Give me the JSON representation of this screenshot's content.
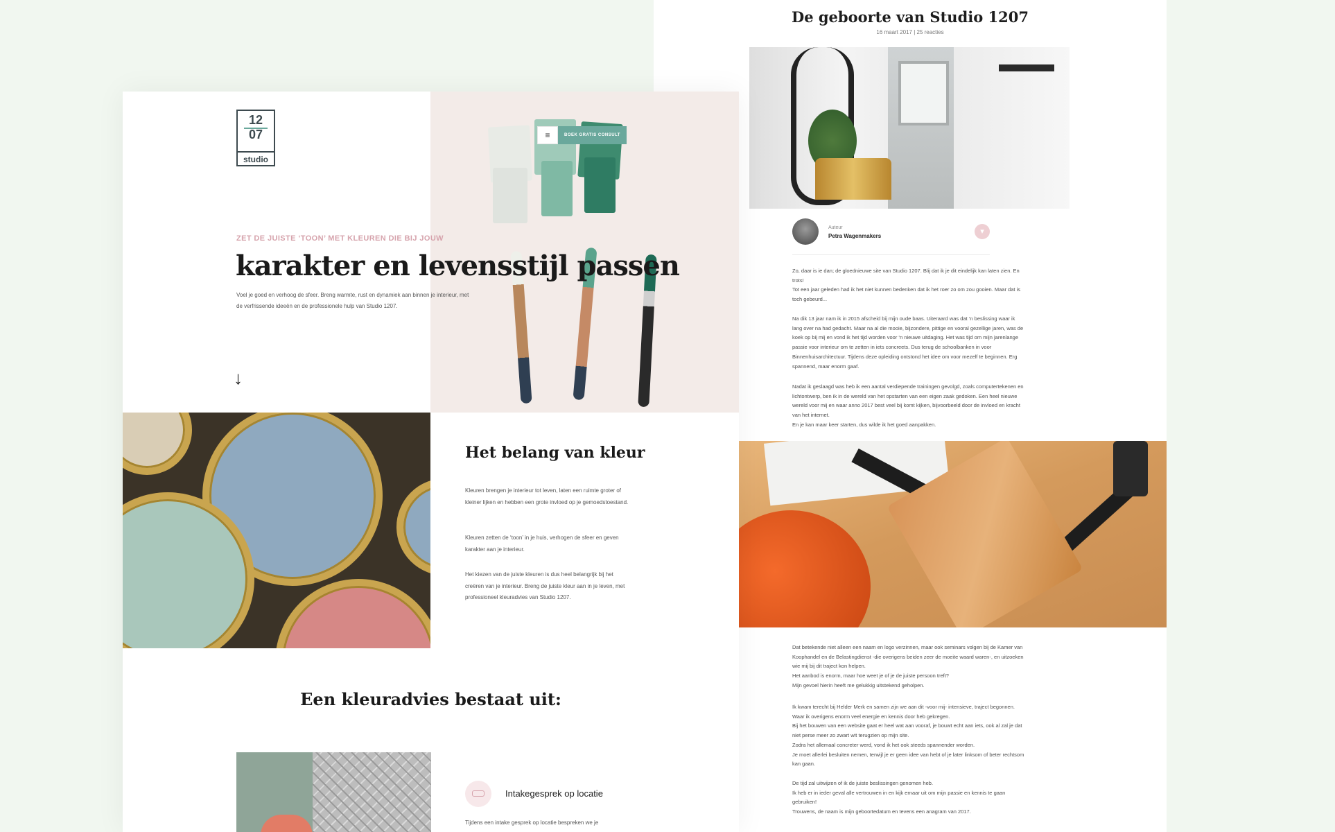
{
  "blog": {
    "title": "De geboorte van Studio 1207",
    "meta": "16 maart 2017 | 25 reacties",
    "author_label": "Auteur",
    "author_name": "Petra Wagenmakers",
    "paragraphs_top": [
      "Zo, daar is ie dan; de gloednieuwe site van Studio 1207. Blij dat ik je dit eindelijk kan laten zien. En trots!\nTot een jaar geleden had ik het niet kunnen bedenken dat ik het roer zo om zou gooien. Maar dat is toch gebeurd...",
      "Na dik 13 jaar nam ik in 2015 afscheid bij mijn oude baas. Uiteraard was dat ‘n beslissing waar ik lang over na had gedacht. Maar na al die mooie, bijzondere, pittige en vooral gezellige jaren, was de koek op bij mij en vond ik het tijd worden voor ‘n nieuwe uitdaging. Het was tijd om mijn jarenlange passie voor interieur om te zetten in iets concreets. Dus terug de schoolbanken in voor Binnenhuisarchitectuur. Tijdens deze opleiding ontstond het idee om voor mezelf te beginnen. Erg spannend, maar enorm gaaf.",
      "Nadat ik geslaagd was heb ik een aantal verdiepende trainingen gevolgd, zoals computertekenen en lichtontwerp, ben ik in de wereld van het opstarten van een eigen zaak gedoken. Een heel nieuwe wereld voor mij en waar anno 2017 best veel bij komt kijken, bijvoorbeeld door de invloed en kracht van het internet.\nEn je kan maar keer starten, dus wilde ik het goed aanpakken."
    ],
    "paragraphs_bottom": [
      "Dat betekende niet alleen een naam en logo verzinnen, maar ook seminars volgen bij de Kamer van Koophandel en de Belastingdienst -die overigens beiden zeer de moeite waard waren-, en uitzoeken wie mij bij dit traject kon helpen.\nHet aanbod is enorm, maar hoe weet je of je de juiste persoon treft?\nMijn gevoel hierin heeft me gelukkig uitstekend geholpen.",
      "Ik kwam terecht bij Helder Merk en samen zijn we aan dit -voor mij- intensieve, traject begonnen. Waar ik overigens enorm veel energie en kennis door heb gekregen.\nBij het bouwen van een website gaat er heel wat aan vooraf, je bouwt echt aan iets, ook al zal je dat niet perse meer zo zwart wit terugzien op mijn site.\nZodra het allemaal concreter werd, vond ik het ook steeds spannender worden.\nJe moet allerlei besluiten nemen, terwijl je er geen idee van hebt of je later linksom of beter rechtsom kan gaan.",
      "De tijd zal uitwijzen of ik de juiste beslissingen genomen heb.\nIk heb er in ieder geval alle vertrouwen in en kijk ernaar uit om mijn passie en kennis te gaan gebruiken!\nTrouwens, de naam is mijn geboortedatum en tevens een anagram van 2017."
    ]
  },
  "main": {
    "logo": {
      "top": "12",
      "bottom": "07",
      "word": "studio"
    },
    "menu_icon": "≡",
    "cta": "BOEK GRATIS CONSULT",
    "eyebrow": "ZET DE  JUISTE ‘TOON’ MET KLEUREN DIE BIJ JOUW",
    "hero_title": "karakter en levensstijl passen",
    "hero_body": "Voel je goed en verhoog de sfeer. Breng warmte, rust en dynamiek aan binnen je interieur, met de verfrissende ideeën en de professionele hulp van Studio 1207.",
    "scroll_icon": "↓",
    "belang_title": "Het belang van kleur",
    "belang_paragraphs": [
      "Kleuren brengen je interieur tot leven, laten een ruimte groter of kleiner lijken en hebben een grote invloed op je gemoedstoestand.",
      "Kleuren zetten de ‘toon’ in je huis, verhogen de sfeer en geven karakter aan je interieur.",
      "Het kiezen van de juiste kleuren is dus heel belangrijk bij het creëren van je interieur. Breng de juiste kleur aan in je leven, met professioneel kleuradvies van Studio 1207."
    ],
    "bestaat_title": "Een kleuradvies bestaat uit:",
    "step_title": "Intakegesprek op locatie",
    "step_body": "Tijdens een intake gesprek op locatie bespreken we je"
  },
  "colors": {
    "accent_teal": "#6aa89c",
    "accent_pink": "#d6a3ac",
    "page_bg": "#f1f7f0"
  }
}
